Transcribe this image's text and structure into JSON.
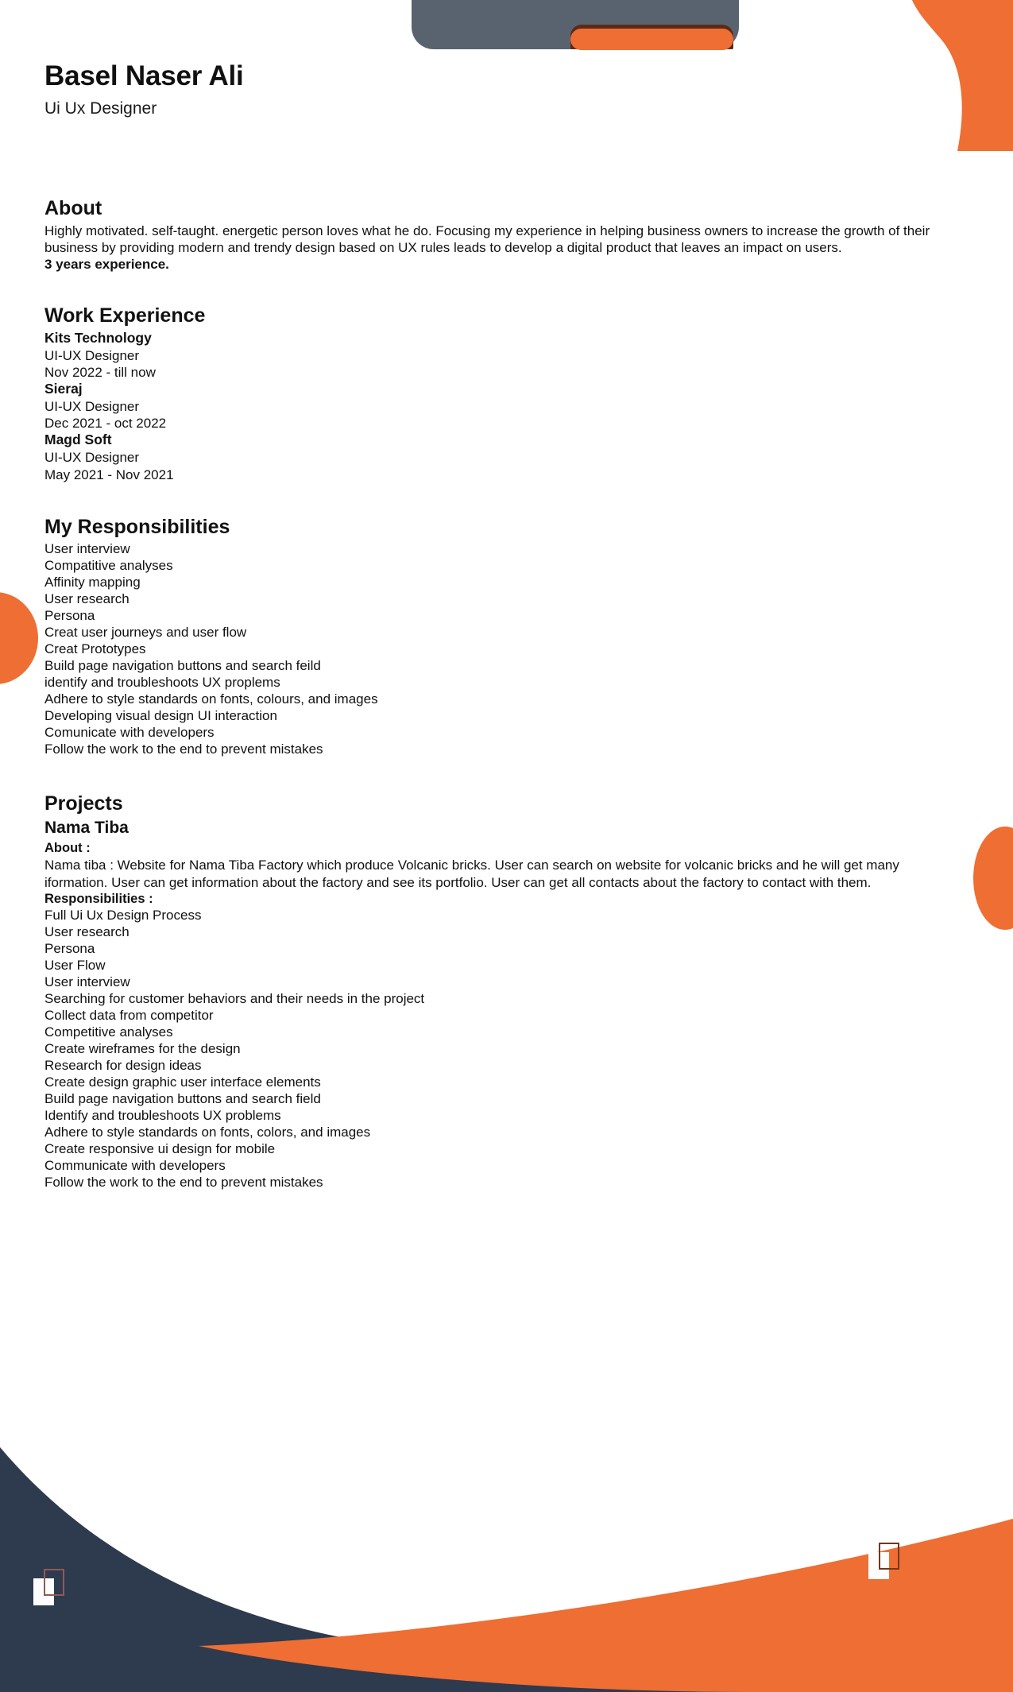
{
  "header": {
    "name": "Basel Naser Ali",
    "role": "Ui Ux Designer"
  },
  "about": {
    "title": "About",
    "paragraph": "Highly motivated. self-taught. energetic person loves what he do. Focusing my experience in helping business owners to increase the growth of their business by providing modern and trendy design based on UX rules leads to develop a digital product that leaves an impact on users.",
    "experience_note": "3 years experience."
  },
  "work_experience": {
    "title": "Work Experience",
    "jobs": [
      {
        "company": "Kits Technology",
        "role": "UI-UX Designer",
        "dates": "Nov 2022 - till now"
      },
      {
        "company": "Sieraj",
        "role": "UI-UX Designer",
        "dates": "Dec 2021 - oct 2022"
      },
      {
        "company": "Magd Soft",
        "role": "UI-UX Designer",
        "dates": "May 2021 - Nov 2021"
      }
    ]
  },
  "responsibilities": {
    "title": "My Responsibilities",
    "items": [
      "User interview",
      "Compatitive analyses",
      "Affinity mapping",
      "User research",
      "Persona",
      "Creat user journeys and user flow",
      "Creat Prototypes",
      "Build page navigation buttons and search feild",
      "identify and troubleshoots UX proplems",
      "Adhere to style standards on fonts, colours, and images",
      "Developing visual design UI interaction",
      "Comunicate with developers",
      "Follow the work to the end to prevent mistakes"
    ]
  },
  "projects": {
    "title": "Projects",
    "items": [
      {
        "name": "Nama Tiba",
        "about_label": "About :",
        "about_text": "Nama tiba : Website for Nama Tiba Factory which produce Volcanic bricks. User can search on website for volcanic bricks and he will get many iformation. User can get information about the factory and see its portfolio. User can get all contacts about the factory to contact with them.",
        "responsibilities_label": "Responsibilities :",
        "responsibilities": [
          "Full Ui Ux Design Process",
          "User research",
          "Persona",
          "User Flow",
          "User interview",
          "Searching for customer behaviors and their needs in the project",
          "Collect data from competitor",
          "Competitive analyses",
          "Create wireframes for the design",
          "Research for design ideas",
          "Create design graphic user interface elements",
          "Build page navigation buttons and search field",
          "Identify and troubleshoots UX problems",
          "Adhere to style standards on fonts, colors, and images",
          "Create responsive ui design for mobile",
          "Communicate with developers",
          "Follow the work to the end to prevent mistakes"
        ]
      }
    ]
  },
  "theme": {
    "accent_orange": "#ee6e33",
    "dark_navy": "#2e3a4e",
    "slate_gray": "#59636f",
    "text": "#111111",
    "page_background": "#ffffff"
  }
}
